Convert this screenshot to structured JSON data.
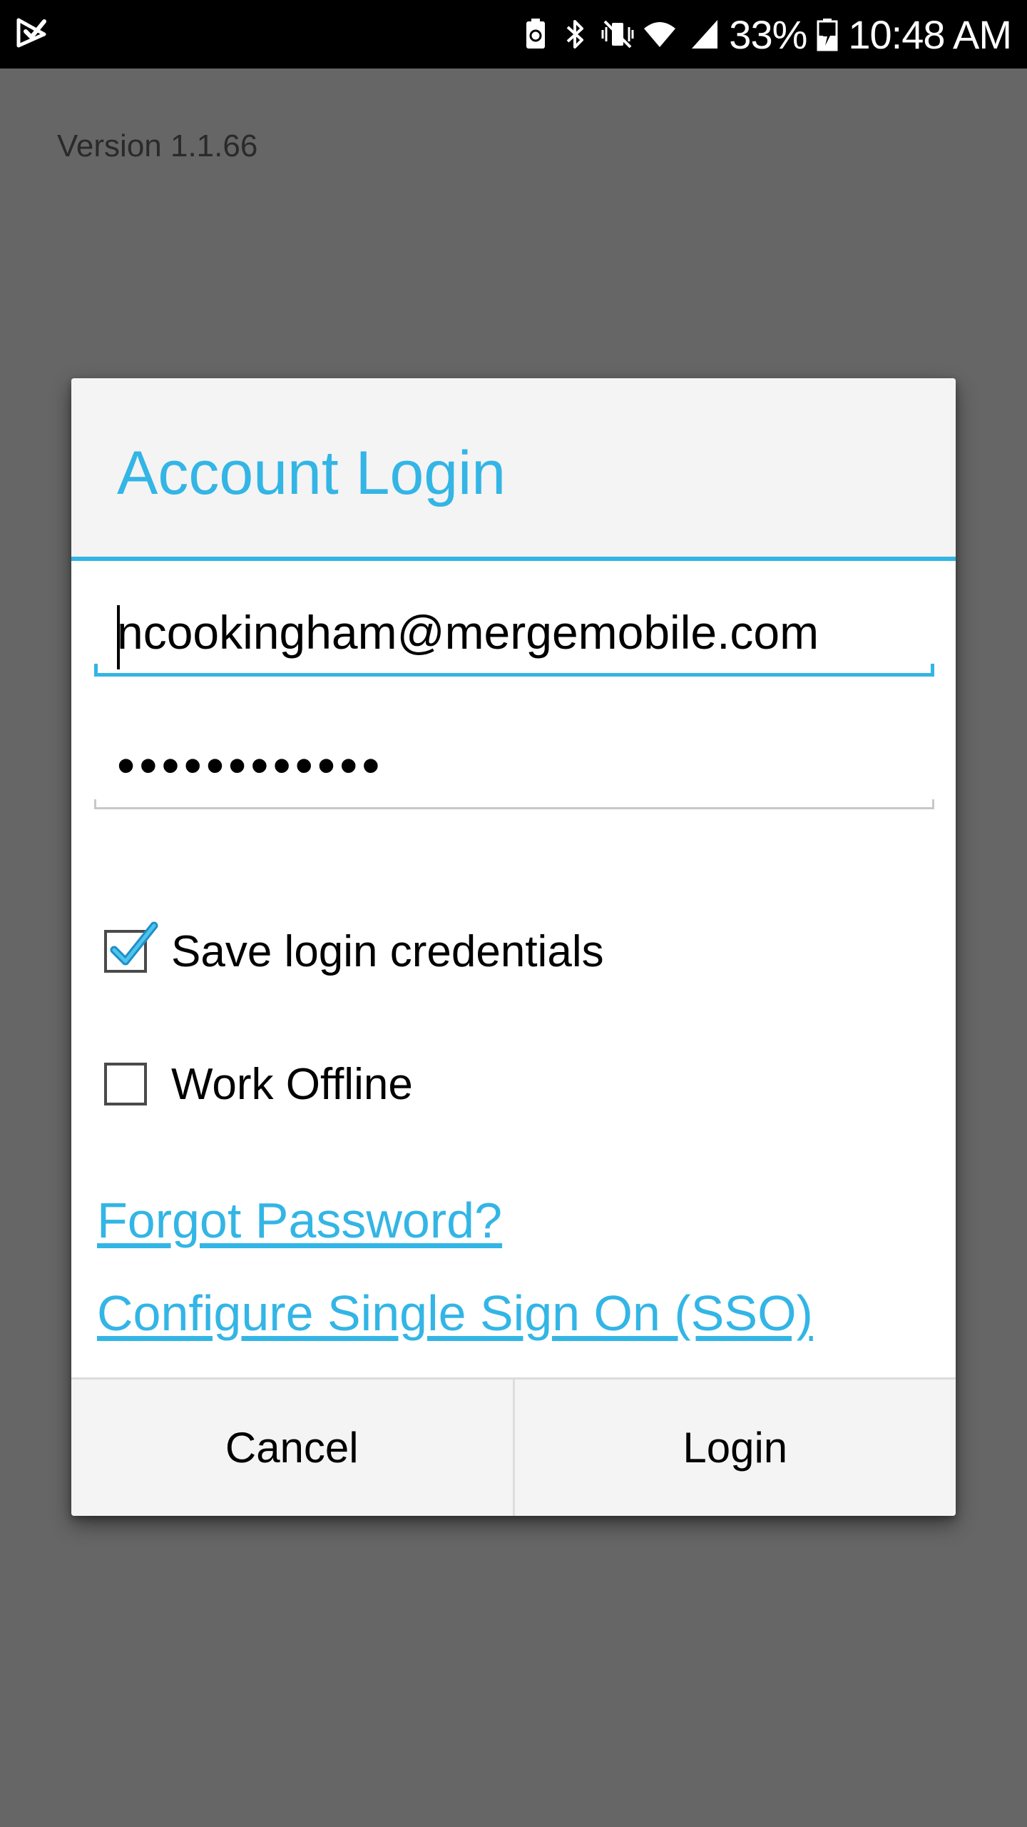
{
  "status_bar": {
    "battery_percent": "33%",
    "time": "10:48 AM",
    "icons": [
      "check-app-icon",
      "battery-saver-icon",
      "bluetooth-icon",
      "vibrate-icon",
      "wifi-icon",
      "cell-signal-icon",
      "battery-charging-icon"
    ]
  },
  "background": {
    "version_text": "Version 1.1.66"
  },
  "dialog": {
    "title": "Account Login",
    "email_value": "ncookingham@mergemobile.com",
    "password_value": "••••••••••••",
    "save_credentials": {
      "label": "Save login credentials",
      "checked": true
    },
    "work_offline": {
      "label": "Work Offline",
      "checked": false
    },
    "forgot_password_link": "Forgot Password?",
    "sso_link": "Configure Single Sign On (SSO)",
    "cancel_label": "Cancel",
    "login_label": "Login"
  },
  "colors": {
    "accent": "#33b5e5",
    "scrim": "#666666",
    "status_bar": "#000000"
  }
}
